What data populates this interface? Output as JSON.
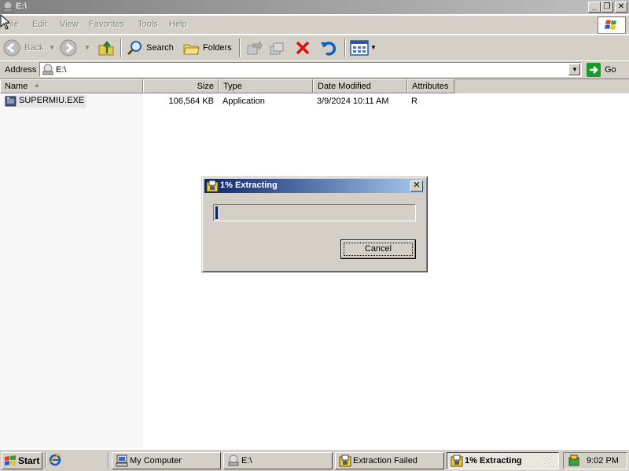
{
  "window": {
    "title": "E:\\",
    "caption_buttons": {
      "minimize": "_",
      "restore": "❐",
      "close": "✕"
    }
  },
  "menu": {
    "items": [
      {
        "label": "File",
        "accel": "F"
      },
      {
        "label": "Edit",
        "accel": "E"
      },
      {
        "label": "View",
        "accel": "V"
      },
      {
        "label": "Favorites",
        "accel": "a"
      },
      {
        "label": "Tools",
        "accel": "T"
      },
      {
        "label": "Help",
        "accel": "H"
      }
    ]
  },
  "toolbar": {
    "back_label": "Back",
    "search_label": "Search",
    "folders_label": "Folders"
  },
  "address": {
    "label": "Address",
    "value": "E:\\",
    "go_label": "Go"
  },
  "list": {
    "columns": [
      "Name",
      "Size",
      "Type",
      "Date Modified",
      "Attributes"
    ],
    "sort_indicator": "▲",
    "rows": [
      {
        "name": "SUPERMIU.EXE",
        "size": "106,564 KB",
        "type": "Application",
        "date": "3/9/2024 10:11 AM",
        "attributes": "R"
      }
    ]
  },
  "dialog": {
    "title": "1% Extracting",
    "progress_percent": 1,
    "cancel_label": "Cancel",
    "close_glyph": "✕"
  },
  "taskbar": {
    "start_label": "Start",
    "tasks": [
      {
        "label": "My Computer",
        "icon": "computer-icon",
        "active": false
      },
      {
        "label": "E:\\",
        "icon": "drive-icon",
        "active": false
      },
      {
        "label": "Extraction Failed",
        "icon": "archive-icon",
        "active": false
      },
      {
        "label": "1% Extracting",
        "icon": "archive-icon",
        "active": true
      }
    ],
    "clock": "9:02 PM"
  },
  "colors": {
    "face": "#d4d0c8",
    "active_title_start": "#0a246a",
    "active_title_end": "#a6caf0",
    "inactive_title": "#808080"
  }
}
